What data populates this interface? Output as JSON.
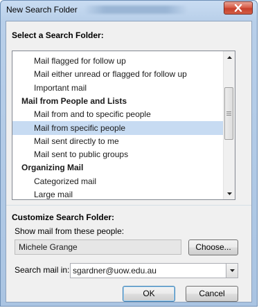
{
  "window": {
    "title": "New Search Folder"
  },
  "select_section": {
    "label": "Select a Search Folder:",
    "rows": [
      {
        "type": "item",
        "label": "Mail flagged for follow up",
        "selected": false
      },
      {
        "type": "item",
        "label": "Mail either unread or flagged for follow up",
        "selected": false
      },
      {
        "type": "item",
        "label": "Important mail",
        "selected": false
      },
      {
        "type": "header",
        "label": "Mail from People and Lists",
        "selected": false
      },
      {
        "type": "item",
        "label": "Mail from and to specific people",
        "selected": false
      },
      {
        "type": "item",
        "label": "Mail from specific people",
        "selected": true
      },
      {
        "type": "item",
        "label": "Mail sent directly to me",
        "selected": false
      },
      {
        "type": "item",
        "label": "Mail sent to public groups",
        "selected": false
      },
      {
        "type": "header",
        "label": "Organizing Mail",
        "selected": false
      },
      {
        "type": "item",
        "label": "Categorized mail",
        "selected": false
      },
      {
        "type": "item",
        "label": "Large mail",
        "selected": false
      }
    ],
    "selected_highlight_color": "#c7dbf2"
  },
  "customize_section": {
    "label": "Customize Search Folder:",
    "people_label": "Show mail from these people:",
    "people_value": "Michele Grange",
    "choose_label": "Choose...",
    "search_in_label": "Search mail in:",
    "search_in_value": "sgardner@uow.edu.au"
  },
  "buttons": {
    "ok": "OK",
    "cancel": "Cancel"
  },
  "colors": {
    "title_bar": "#b8cfe9",
    "close_button": "#d35f46"
  }
}
